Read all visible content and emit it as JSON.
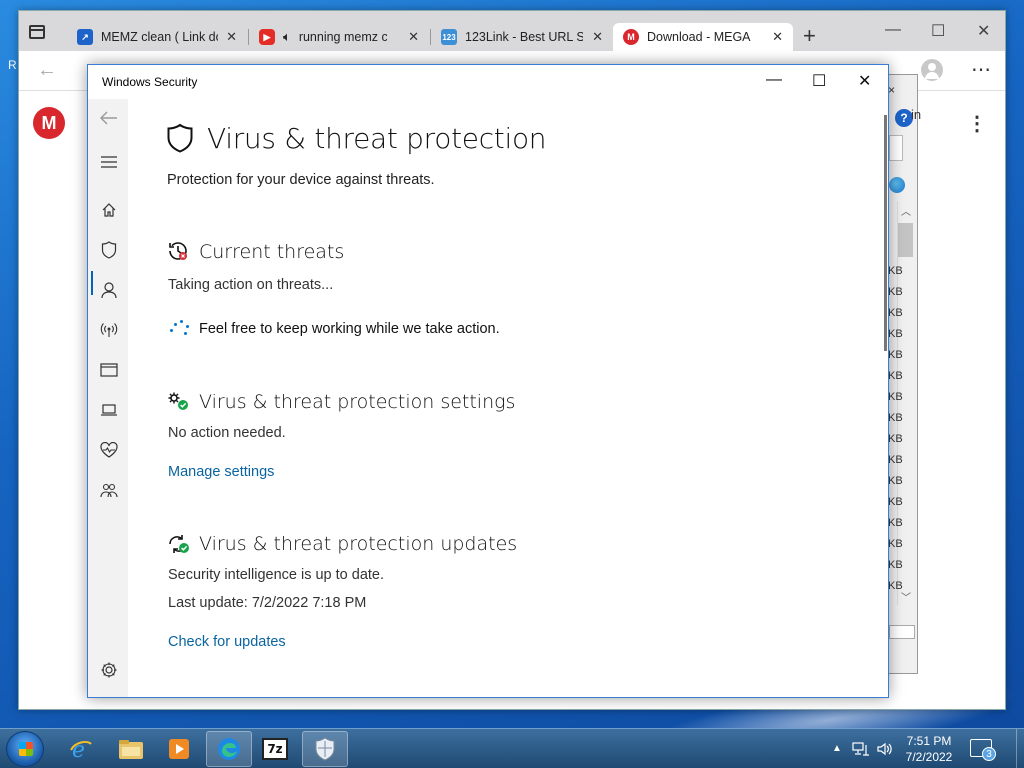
{
  "desktop": {
    "edge_text": "R"
  },
  "browser": {
    "tabs": [
      {
        "title": "MEMZ clean ( Link do",
        "favicon": "memz-favicon",
        "color": "#1d63c9"
      },
      {
        "title": "running memz c",
        "favicon": "youtube-favicon",
        "color": "#e52d27",
        "audio": "speaker-icon"
      },
      {
        "title": "123Link - Best URL Sh",
        "favicon": "123link-favicon",
        "color": "#3d8fd6",
        "favicon_text": "123"
      },
      {
        "title": "Download - MEGA",
        "favicon": "mega-favicon",
        "color": "#d9272e",
        "favicon_text": "M"
      }
    ],
    "new_tab": "+",
    "page": {
      "logo_text": "M"
    }
  },
  "bg_dialog": {
    "close": "×",
    "help": "?",
    "in_text": "in",
    "kb_labels": [
      "KB",
      "KB",
      "KB",
      "KB",
      "KB",
      "KB",
      "KB",
      "KB",
      "KB",
      "KB",
      "KB",
      "KB",
      "KB",
      "KB",
      "KB",
      "KB"
    ]
  },
  "security": {
    "window_title": "Windows Security",
    "page_title": "Virus & threat protection",
    "subtitle": "Protection for your device against threats.",
    "sections": {
      "current_threats": {
        "heading": "Current threats",
        "status": "Taking action on threats...",
        "progress_text": "Feel free to keep working while we take action."
      },
      "settings": {
        "heading": "Virus & threat protection settings",
        "status": "No action needed.",
        "link": "Manage settings"
      },
      "updates": {
        "heading": "Virus & threat protection updates",
        "status": "Security intelligence is up to date.",
        "last_update": "Last update: 7/2/2022 7:18 PM",
        "link": "Check for updates"
      }
    },
    "colors": {
      "accent": "#0067b8",
      "link": "#0a64a0",
      "ok_green": "#16a34a",
      "alert_red": "#d13438"
    }
  },
  "taskbar": {
    "clock_time": "7:51 PM",
    "clock_date": "7/2/2022",
    "notification_count": "3",
    "apps": [
      "ie-icon",
      "explorer-icon",
      "media-player-icon",
      "edge-icon",
      "7zip-icon",
      "windows-security-icon"
    ],
    "app_7z_text": "7z"
  }
}
